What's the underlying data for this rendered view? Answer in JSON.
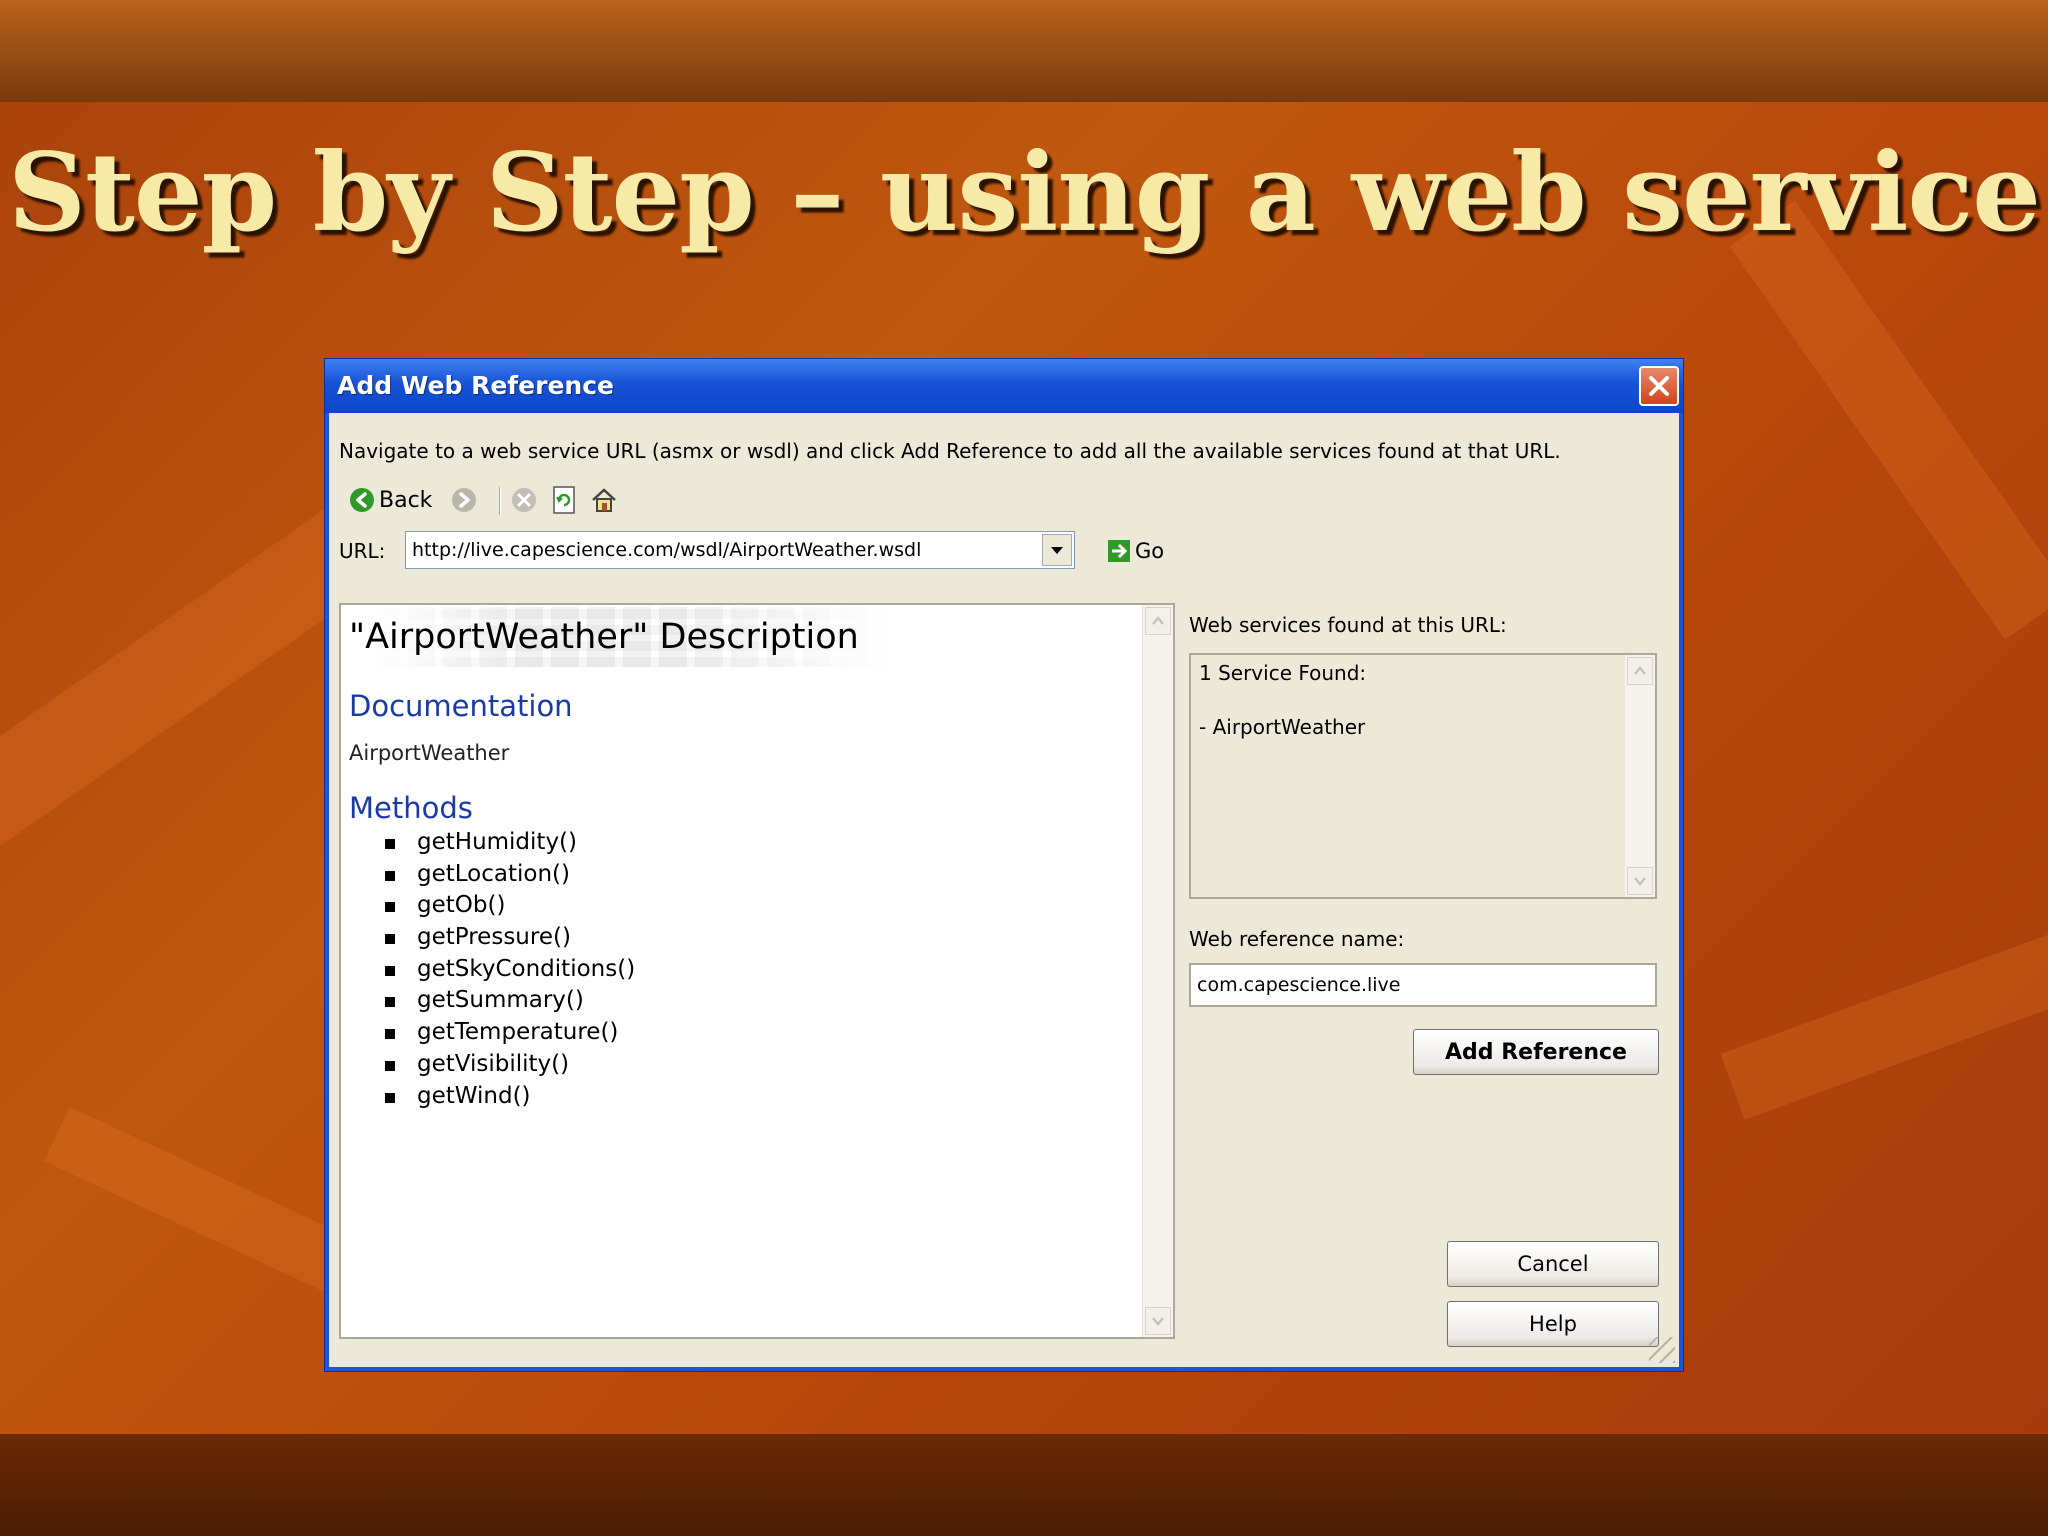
{
  "slide": {
    "title": "Step by Step – using a web service"
  },
  "dialog": {
    "title": "Add Web Reference",
    "instruction": "Navigate to a web service URL (asmx or wsdl) and click Add Reference to add all the available services found at that URL.",
    "toolbar": {
      "back_label": "Back"
    },
    "url_label": "URL:",
    "url_value": "http://live.capescience.com/wsdl/AirportWeather.wsdl",
    "go_label": "Go",
    "browser": {
      "description_title": "\"AirportWeather\" Description",
      "documentation_heading": "Documentation",
      "documentation_text": "AirportWeather",
      "methods_heading": "Methods",
      "methods": [
        "getHumidity()",
        "getLocation()",
        "getOb()",
        "getPressure()",
        "getSkyConditions()",
        "getSummary()",
        "getTemperature()",
        "getVisibility()",
        "getWind()"
      ]
    },
    "found": {
      "label": "Web services found at this URL:",
      "count_text": "1 Service Found:",
      "item": "- AirportWeather"
    },
    "reference_name": {
      "label": "Web reference name:",
      "value": "com.capescience.live"
    },
    "buttons": {
      "add_reference": "Add Reference",
      "cancel": "Cancel",
      "help": "Help"
    }
  }
}
